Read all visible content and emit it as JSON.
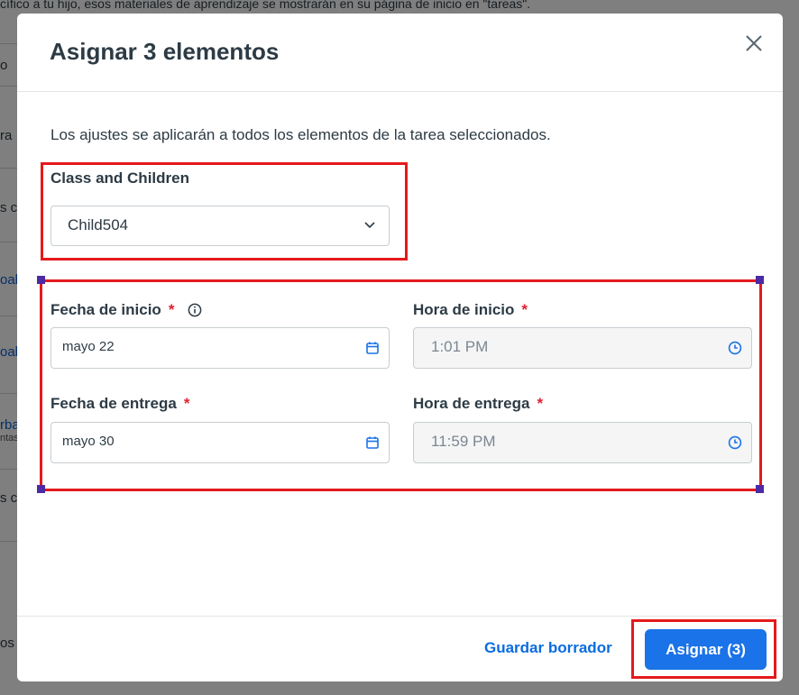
{
  "background": {
    "top_text": "cífico a tu hijo, esos materiales de aprendizaje se mostrarán en su página de inicio en \"tareas\".",
    "rows": [
      {
        "text": "o",
        "link": false
      },
      {
        "text": "ra",
        "link": false
      },
      {
        "text": "s c",
        "link": false
      },
      {
        "text": "oal",
        "link": true
      },
      {
        "text": "oal",
        "link": true
      },
      {
        "text": "rba",
        "link": true,
        "sub": "ntas"
      },
      {
        "text": "s c",
        "link": false
      },
      {
        "text": "os",
        "link": false
      }
    ]
  },
  "modal": {
    "title": "Asignar 3 elementos",
    "close_icon": "close-icon",
    "intro": "Los ajustes se aplicarán a todos los elementos de la tarea seleccionados.",
    "class_label": "Class and Children",
    "class_value": "Child504",
    "start_date_label": "Fecha de inicio",
    "start_date_value": "mayo 22",
    "start_time_label": "Hora de inicio",
    "start_time_value": "1:01 PM",
    "due_date_label": "Fecha de entrega",
    "due_date_value": "mayo 30",
    "due_time_label": "Hora de entrega",
    "due_time_value": "11:59 PM",
    "required_mark": "*",
    "draft_button": "Guardar borrador",
    "assign_button": "Asignar (3)"
  },
  "colors": {
    "accent": "#1a73e8",
    "link": "#0b6be0",
    "required": "#e0222f",
    "annotation": "#e41a1c"
  }
}
